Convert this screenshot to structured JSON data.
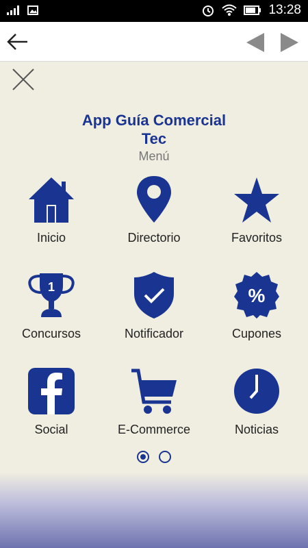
{
  "status_bar": {
    "time": "13:28",
    "icons": [
      "signal-icon",
      "image-icon",
      "alarm-icon",
      "wifi-icon",
      "battery-icon"
    ]
  },
  "toolbar": {
    "icons": [
      "back-arrow-icon",
      "previous-triangle-icon",
      "next-triangle-icon"
    ]
  },
  "menu": {
    "title_line1": "App Guía Comercial",
    "title_line2": "Tec",
    "subtitle": "Menú",
    "items": [
      {
        "label": "Inicio",
        "icon": "home-icon"
      },
      {
        "label": "Directorio",
        "icon": "map-pin-icon"
      },
      {
        "label": "Favoritos",
        "icon": "star-icon"
      },
      {
        "label": "Concursos",
        "icon": "trophy-icon"
      },
      {
        "label": "Notificador",
        "icon": "shield-check-icon"
      },
      {
        "label": "Cupones",
        "icon": "percent-badge-icon"
      },
      {
        "label": "Social",
        "icon": "facebook-icon"
      },
      {
        "label": "E-Commerce",
        "icon": "shopping-cart-icon"
      },
      {
        "label": "Noticias",
        "icon": "clock-icon"
      }
    ]
  },
  "pagination": {
    "pages": 2,
    "current": 1
  },
  "colors": {
    "accent": "#1a3591",
    "background": "#f0ede1"
  }
}
